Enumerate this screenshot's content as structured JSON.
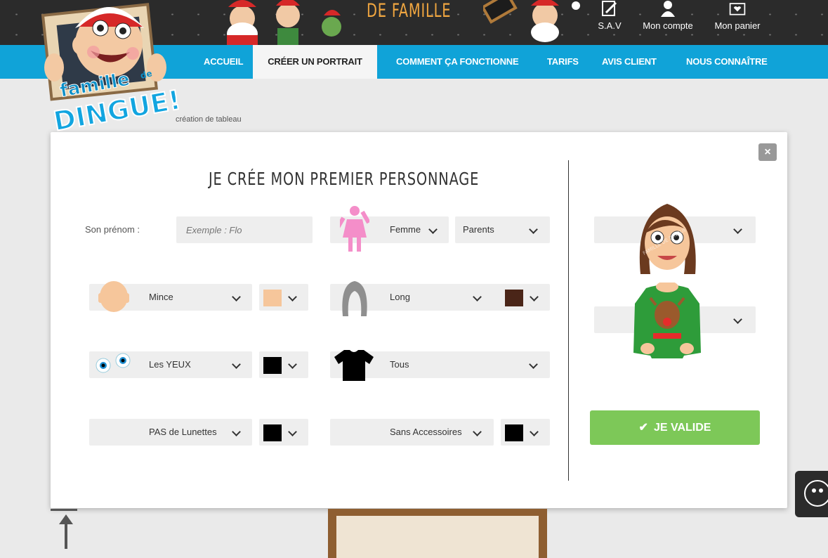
{
  "header": {
    "tagline": "DE FAMILLE",
    "links": [
      {
        "label": "S.A.V",
        "icon": "write-icon"
      },
      {
        "label": "Mon compte",
        "icon": "account-icon"
      },
      {
        "label": "Mon panier",
        "icon": "basket-icon"
      }
    ]
  },
  "nav": {
    "items": [
      "ACCUEIL",
      "CRÉER UN PORTRAIT",
      "COMMENT ÇA FONCTIONNE",
      "TARIFS",
      "AVIS CLIENT",
      "NOUS CONNAÎTRE"
    ],
    "active": "CRÉER UN PORTRAIT"
  },
  "logo": {
    "text_top": "famille",
    "text_de": "de",
    "text_main": "DINGUE!"
  },
  "breadcrumb": "création de tableau",
  "modal": {
    "title": "JE CRÉE MON PREMIER PERSONNAGE",
    "close": "×",
    "firstname_label": "Son prénom :",
    "firstname_placeholder": "Exemple : Flo",
    "gender": "Femme",
    "role": "Parents",
    "body": "Mince",
    "skin_color": "#f6c69b",
    "hair": "Long",
    "hair_color": "#4a2518",
    "eyes": "Les YEUX",
    "eyes_color": "#000000",
    "top": "Tous",
    "glasses": "PAS de Lunettes",
    "glasses_color": "#000000",
    "accessories": "Sans Accessoires",
    "accessories_color": "#000000",
    "head_select": "",
    "body_select": "",
    "validate": "JE VALIDE",
    "watermark": "FAMILLE DE DINGUE"
  },
  "colors": {
    "nav_blue": "#10a3d8",
    "validate_green": "#7dc858",
    "header_dark": "#2b2b2b",
    "tagline_orange": "#f0a640"
  }
}
